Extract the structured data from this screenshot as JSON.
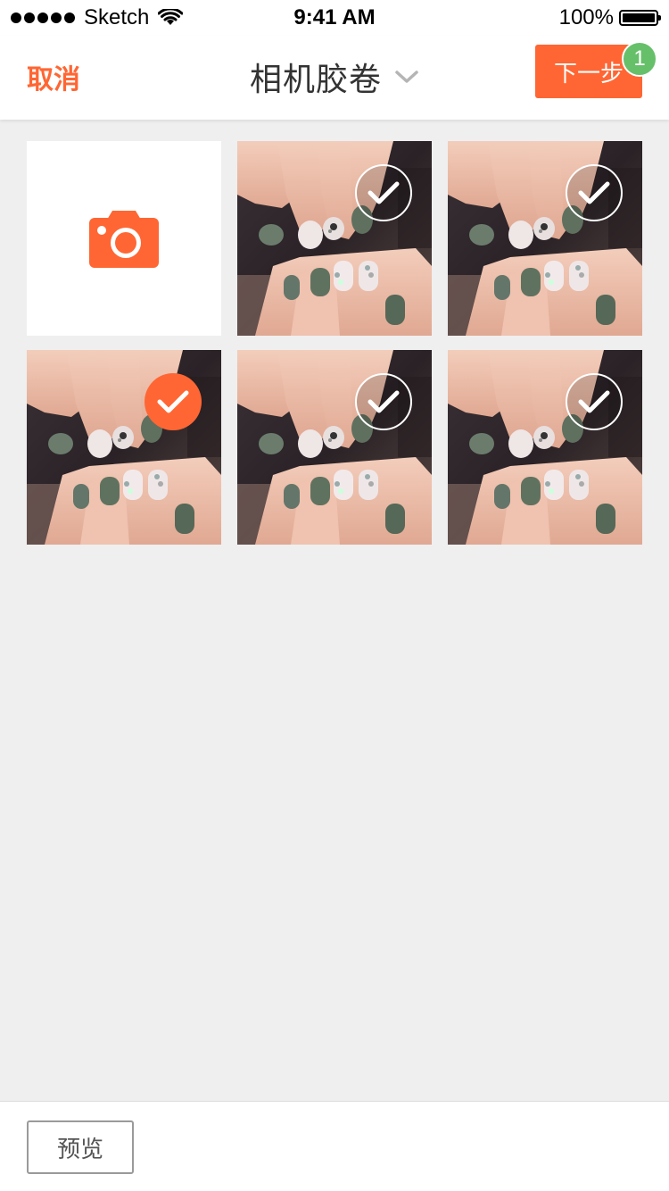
{
  "status_bar": {
    "carrier": "Sketch",
    "time": "9:41 AM",
    "battery": "100%"
  },
  "nav": {
    "cancel_label": "取消",
    "title": "相机胶卷",
    "next_label": "下一步",
    "selected_count": "1"
  },
  "colors": {
    "accent": "#ff6633",
    "badge": "#66c06a",
    "background": "#efefef"
  },
  "grid": {
    "camera_icon": "camera-icon",
    "photos": [
      {
        "selected": false
      },
      {
        "selected": false
      },
      {
        "selected": true
      },
      {
        "selected": false
      },
      {
        "selected": false
      }
    ]
  },
  "bottom": {
    "preview_label": "预览"
  }
}
